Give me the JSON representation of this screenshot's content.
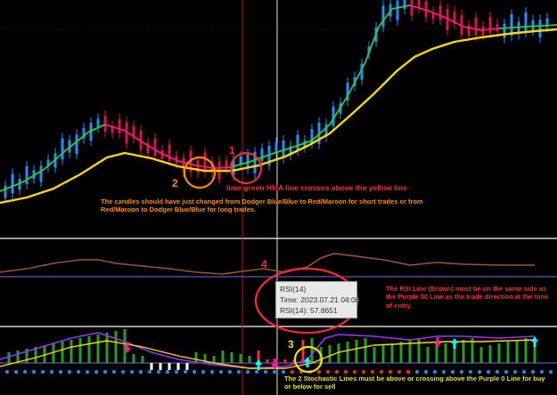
{
  "colors": {
    "background": "#000000",
    "hma_up": "#32cd32",
    "hma_down": "#ff1493",
    "ma_yellow": "#ffd700",
    "candle_up": "#1e90ff",
    "candle_down": "#dc143c",
    "rsi_line": "#a0522d",
    "level_line": "#7b68ee",
    "annotation_red": "#ff2a2a",
    "annotation_orange": "#ff8c00",
    "annotation_yellow": "#ffff00",
    "annotation_pink": "#ff69b4",
    "panel_separator": "#cfcfcf",
    "crosshair": "#e0e0e0"
  },
  "annotations": {
    "step1_number": "1",
    "step2_number": "2",
    "step3_number": "3",
    "step4_number": "4",
    "hma_cross_note": "lime green HMA line crosses above the yellow line",
    "candle_note": "The candles should have just changed from Dodger Blue/Blue to Red/Maroon for short trades or from Red/Maroon to Dodger Blue/Blue for long trades.",
    "rsi_note": "The RSI Line (Brown) must be on the same side as the Purple 50 Line as the trade direction at the time of entry.",
    "stochastic_note": "The 2 Stochastic Lines must be above or crossing above the Purple 0 Line for buy or below for sell"
  },
  "tooltip": {
    "title": "RSI(14)",
    "time_line": "Time: 2023.07.21 04:00",
    "value_line": "RSI(14): 57.8651"
  }
}
